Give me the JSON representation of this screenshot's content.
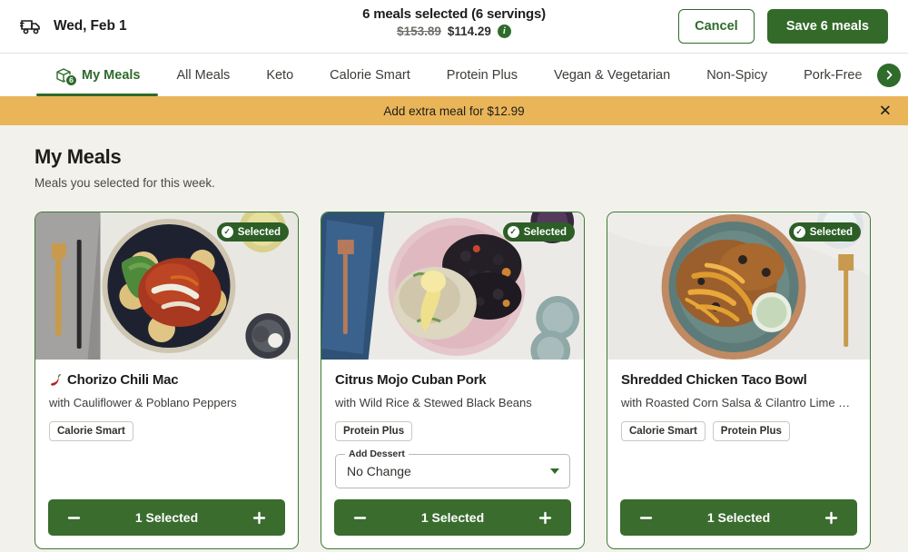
{
  "header": {
    "truck_icon": "delivery-truck-icon",
    "date": "Wed, Feb 1",
    "selection_summary": "6 meals selected (6 servings)",
    "price_original": "$153.89",
    "price_current": "$114.29",
    "info_icon": "i",
    "cancel_label": "Cancel",
    "save_label": "Save 6 meals"
  },
  "tabs": {
    "items": [
      {
        "label": "My Meals",
        "badge": "6",
        "active": true
      },
      {
        "label": "All Meals",
        "active": false
      },
      {
        "label": "Keto",
        "active": false
      },
      {
        "label": "Calorie Smart",
        "active": false
      },
      {
        "label": "Protein Plus",
        "active": false
      },
      {
        "label": "Vegan & Vegetarian",
        "active": false
      },
      {
        "label": "Non-Spicy",
        "active": false
      },
      {
        "label": "Pork-Free",
        "active": false
      }
    ],
    "scroll_right_icon": "›"
  },
  "promo": {
    "text": "Add extra meal for $12.99",
    "close_icon": "✕",
    "background": "#eab559"
  },
  "page": {
    "title": "My Meals",
    "subtitle": "Meals you selected for this week."
  },
  "colors": {
    "brand_green": "#2f6b2b",
    "stepper_green": "#3a6c2e",
    "badge_green": "#2c5e26",
    "promo_amber": "#eab559",
    "page_bg": "#f2f1ec"
  },
  "meals": [
    {
      "title": "Chorizo Chili Mac",
      "subtitle": "with Cauliflower & Poblano Peppers",
      "spicy": true,
      "spicy_icon": "chili-pepper-icon",
      "tags": [
        "Calorie Smart"
      ],
      "selected_badge": "Selected",
      "quantity_label": "1 Selected",
      "minus_icon": "minus-icon",
      "plus_icon": "plus-icon",
      "has_dessert_select": false
    },
    {
      "title": "Citrus Mojo Cuban Pork",
      "subtitle": "with Wild Rice & Stewed Black Beans",
      "spicy": false,
      "tags": [
        "Protein Plus"
      ],
      "selected_badge": "Selected",
      "quantity_label": "1 Selected",
      "minus_icon": "minus-icon",
      "plus_icon": "plus-icon",
      "has_dessert_select": true,
      "dessert_label": "Add Dessert",
      "dessert_value": "No Change"
    },
    {
      "title": "Shredded Chicken Taco Bowl",
      "subtitle": "with Roasted Corn Salsa & Cilantro Lime Sour…",
      "spicy": false,
      "tags": [
        "Calorie Smart",
        "Protein Plus"
      ],
      "selected_badge": "Selected",
      "quantity_label": "1 Selected",
      "minus_icon": "minus-icon",
      "plus_icon": "plus-icon",
      "has_dessert_select": false
    }
  ]
}
